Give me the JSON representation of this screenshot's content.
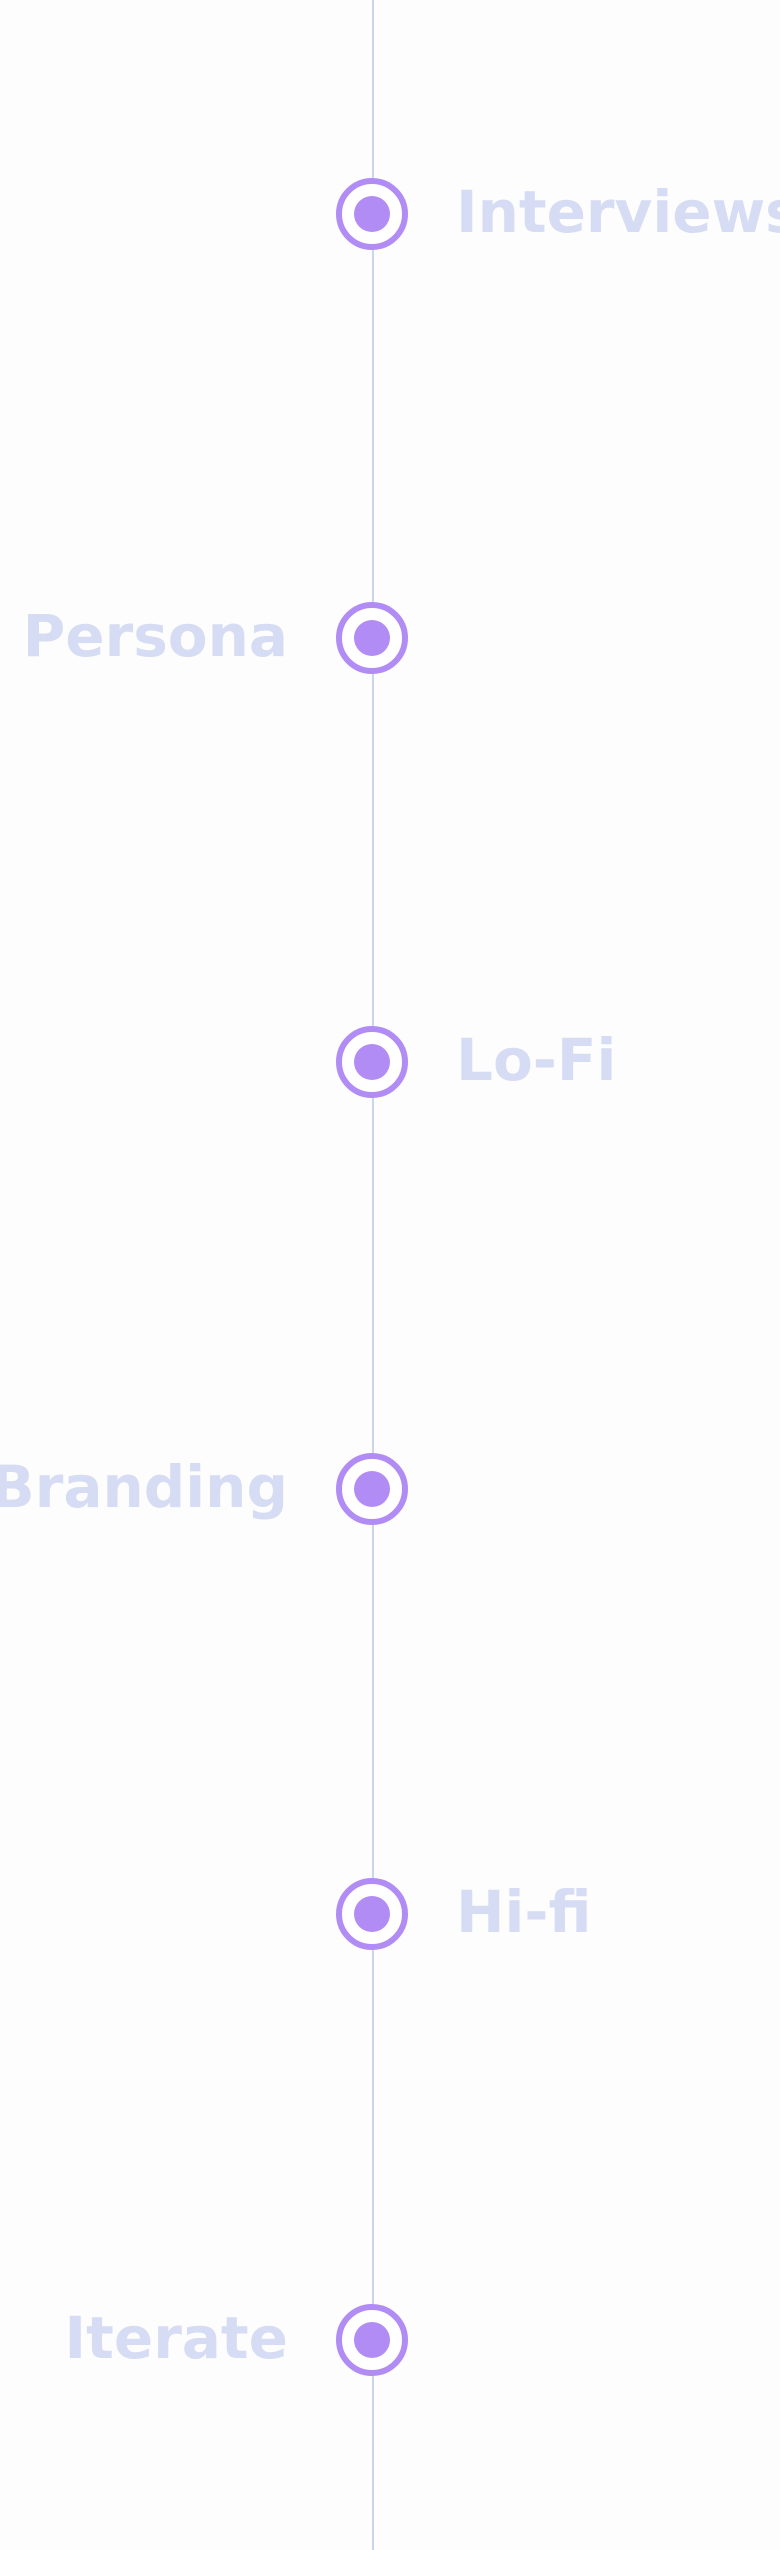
{
  "colors": {
    "node": "#b18cf5",
    "line": "#c9d6ee",
    "label": "#d5dcf3",
    "background": "#fdfdfd"
  },
  "steps": [
    {
      "label": "Interviews",
      "side": "right"
    },
    {
      "label": "Persona",
      "side": "left"
    },
    {
      "label": "Lo-Fi",
      "side": "right"
    },
    {
      "label": "Branding",
      "side": "left"
    },
    {
      "label": "Hi-fi",
      "side": "right"
    },
    {
      "label": "Iterate",
      "side": "left"
    }
  ]
}
